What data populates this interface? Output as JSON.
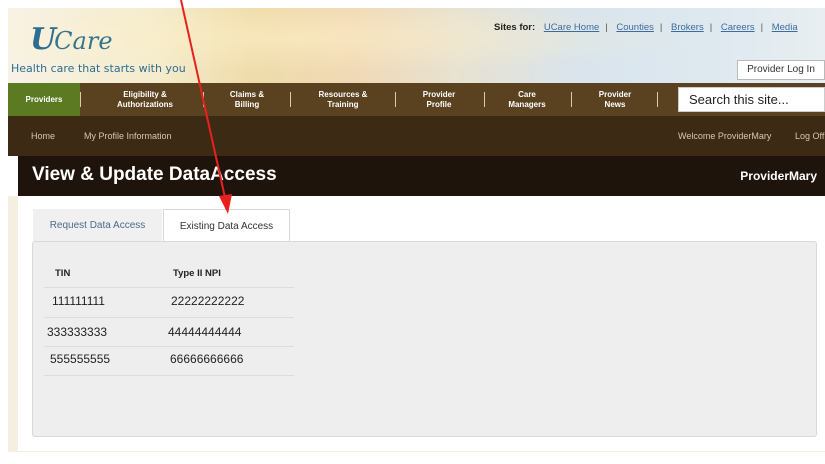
{
  "brand": {
    "logo_u": "U",
    "logo_rest": "Care",
    "tagline": "Health care that starts with you"
  },
  "sites": {
    "label": "Sites for:",
    "links": [
      "UCare Home",
      "Counties",
      "Brokers",
      "Careers",
      "Media"
    ]
  },
  "login": {
    "label": "Provider Log In"
  },
  "nav": {
    "items": [
      {
        "line1": "Providers",
        "line2": ""
      },
      {
        "line1": "Eligibility &",
        "line2": "Authorizations"
      },
      {
        "line1": "Claims &",
        "line2": "Billing"
      },
      {
        "line1": "Resources &",
        "line2": "Training"
      },
      {
        "line1": "Provider",
        "line2": "Profile"
      },
      {
        "line1": "Care",
        "line2": "Managers"
      },
      {
        "line1": "Provider",
        "line2": "News"
      }
    ],
    "search_placeholder": "Search this site..."
  },
  "subnav": {
    "home": "Home",
    "profile": "My Profile Information",
    "welcome": "Welcome ProviderMary",
    "logoff": "Log Off"
  },
  "page": {
    "title": "View & Update DataAccess",
    "user": "ProviderMary"
  },
  "tabs": {
    "request": "Request Data Access",
    "existing": "Existing Data Access"
  },
  "table": {
    "headers": [
      "TIN",
      "Type II NPI"
    ],
    "rows": [
      [
        "111111111",
        "22222222222"
      ],
      [
        "333333333",
        "44444444444"
      ],
      [
        "555555555",
        "66666666666"
      ]
    ]
  },
  "colors": {
    "nav_bg": "#5a4120",
    "nav_active": "#5c7a22",
    "subnav_bg": "#3d2a14",
    "title_bg": "#1f140b",
    "annotation_arrow": "#e8201e"
  }
}
